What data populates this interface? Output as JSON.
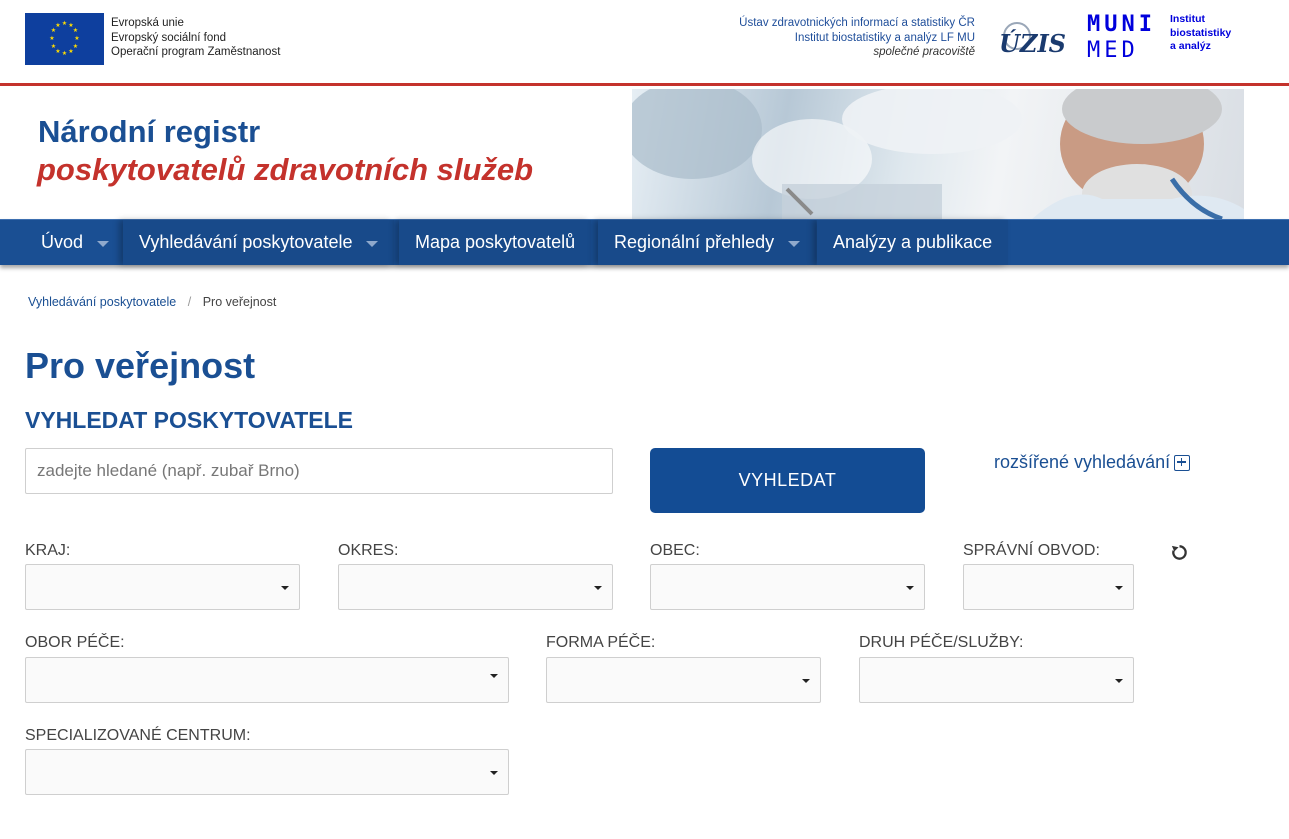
{
  "eu": {
    "lines": [
      "Evropská unie",
      "Evropský sociální fond",
      "Operační program Zaměstnanost"
    ]
  },
  "uzis": {
    "line1": "Ústav zdravotnických informací a statistiky ČR",
    "line2": "Institut biostatistiky a analýz LF MU",
    "line3": "společné pracoviště",
    "logo_text": "ÚZIS"
  },
  "muni": {
    "line1": "MUNI",
    "line2": "MED",
    "sub": [
      "Institut",
      "biostatistiky",
      "a analýz"
    ]
  },
  "header": {
    "title_line1": "Národní registr",
    "title_line2": "poskytovatelů zdravotních služeb"
  },
  "nav": {
    "items": [
      {
        "label": "Úvod",
        "dropdown": true
      },
      {
        "label": "Vyhledávání poskytovatele",
        "dropdown": true
      },
      {
        "label": "Mapa poskytovatelů",
        "dropdown": false
      },
      {
        "label": "Regionální přehledy",
        "dropdown": true
      },
      {
        "label": "Analýzy a publikace",
        "dropdown": false
      }
    ]
  },
  "breadcrumb": {
    "link": "Vyhledávání poskytovatele",
    "separator": "/",
    "current": "Pro veřejnost"
  },
  "page": {
    "title": "Pro veřejnost",
    "section_title": "VYHLEDAT POSKYTOVATELE"
  },
  "search": {
    "placeholder": "zadejte hledané (např. zubař Brno)",
    "value": "",
    "button_label": "VYHLEDAT",
    "advanced_label": "rozšířené vyhledávání"
  },
  "filters": {
    "kraj": {
      "label": "KRAJ:",
      "value": ""
    },
    "okres": {
      "label": "OKRES:",
      "value": ""
    },
    "obec": {
      "label": "OBEC:",
      "value": ""
    },
    "spravni_obvod": {
      "label": "SPRÁVNÍ OBVOD:",
      "value": ""
    },
    "obor_pece": {
      "label": "OBOR PÉČE:",
      "value": ""
    },
    "forma_pece": {
      "label": "FORMA PÉČE:",
      "value": ""
    },
    "druh_pece": {
      "label": "DRUH PÉČE/SLUŽBY:",
      "value": ""
    },
    "specializovane_centrum": {
      "label": "SPECIALIZOVANÉ CENTRUM:",
      "value": ""
    }
  },
  "colors": {
    "primary": "#1a4f93",
    "accent_red": "#c4322c",
    "button": "#134c94",
    "muni_blue": "#0000dc"
  }
}
